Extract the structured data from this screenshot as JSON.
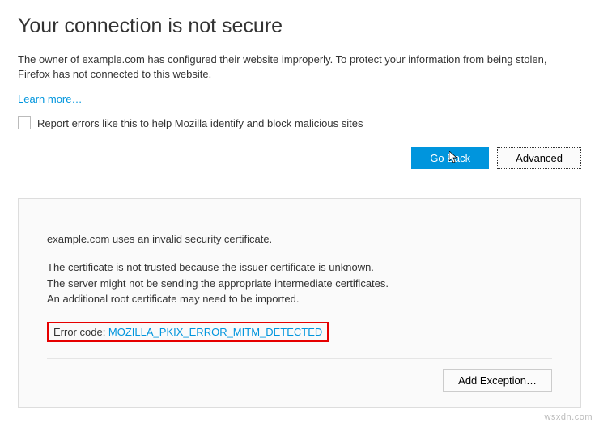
{
  "title": "Your connection is not secure",
  "description": "The owner of example.com has configured their website improperly. To protect your information from being stolen, Firefox has not connected to this website.",
  "learn_more": "Learn more…",
  "checkbox_label": "Report errors like this to help Mozilla identify and block malicious sites",
  "buttons": {
    "go_back": "Go Back",
    "advanced": "Advanced"
  },
  "details": {
    "cert_line": "example.com uses an invalid security certificate.",
    "info_line1": "The certificate is not trusted because the issuer certificate is unknown.",
    "info_line2": "The server might not be sending the appropriate intermediate certificates.",
    "info_line3": "An additional root certificate may need to be imported.",
    "error_label": "Error code: ",
    "error_code": "MOZILLA_PKIX_ERROR_MITM_DETECTED",
    "add_exception": "Add Exception…"
  },
  "watermark": "wsxdn.com"
}
